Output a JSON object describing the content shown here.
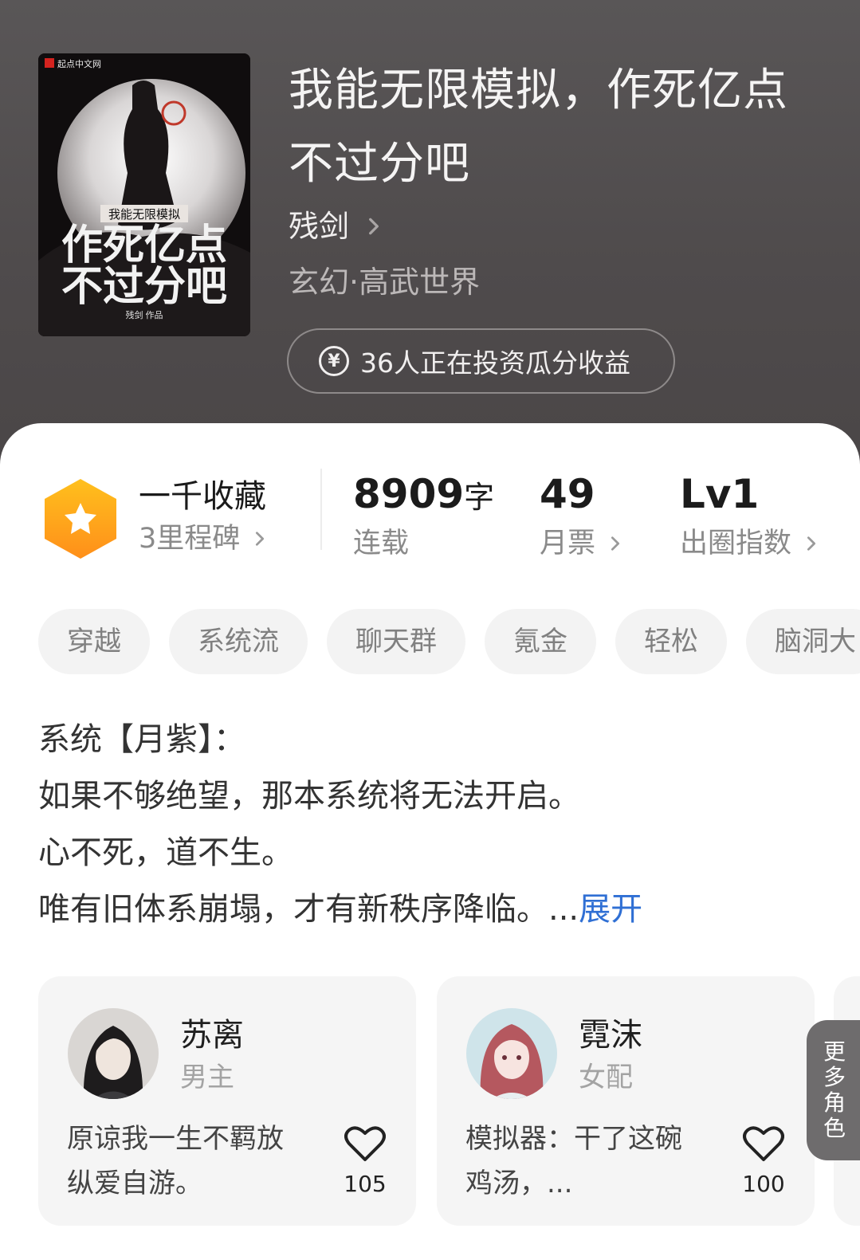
{
  "book": {
    "title": "我能无限模拟，作死亿点不过分吧",
    "author": "残剑",
    "genre": "玄幻·高武世界",
    "invest_text": "36人正在投资瓜分收益",
    "cover": {
      "publisher": "起点中文网",
      "series_line": "我能无限模拟",
      "title_line1": "作死亿点",
      "title_line2": "不过分吧",
      "author_line": "残剑 作品"
    }
  },
  "stats": {
    "collect": {
      "title": "一千收藏",
      "sub": "3里程碑"
    },
    "words": {
      "value": "8909",
      "unit": "字",
      "label": "连载"
    },
    "votes": {
      "value": "49",
      "label": "月票"
    },
    "index": {
      "value": "Lv1",
      "label": "出圈指数"
    }
  },
  "tags": [
    "穿越",
    "系统流",
    "聊天群",
    "氪金",
    "轻松",
    "脑洞大"
  ],
  "description": {
    "lines": [
      "系统【月紫】：",
      "如果不够绝望，那本系统将无法开启。",
      "心不死，道不生。",
      "唯有旧体系崩塌，才有新秩序降临。..."
    ],
    "expand": "展开"
  },
  "characters": [
    {
      "name": "苏离",
      "role": "男主",
      "quote": "原谅我一生不羁放纵爱自游。",
      "likes": "105"
    },
    {
      "name": "霓沫",
      "role": "女配",
      "quote": "模拟器：干了这碗鸡汤，...",
      "likes": "100"
    }
  ],
  "more_roles": "更多角色",
  "colors": {
    "accent": "#2f6fd4",
    "badge_orange": "#ffa21c"
  },
  "icons": {
    "author": "chevron-right-icon",
    "invest": "yen-coin-icon",
    "badge": "star-hexagon-icon",
    "like": "heart-icon"
  }
}
